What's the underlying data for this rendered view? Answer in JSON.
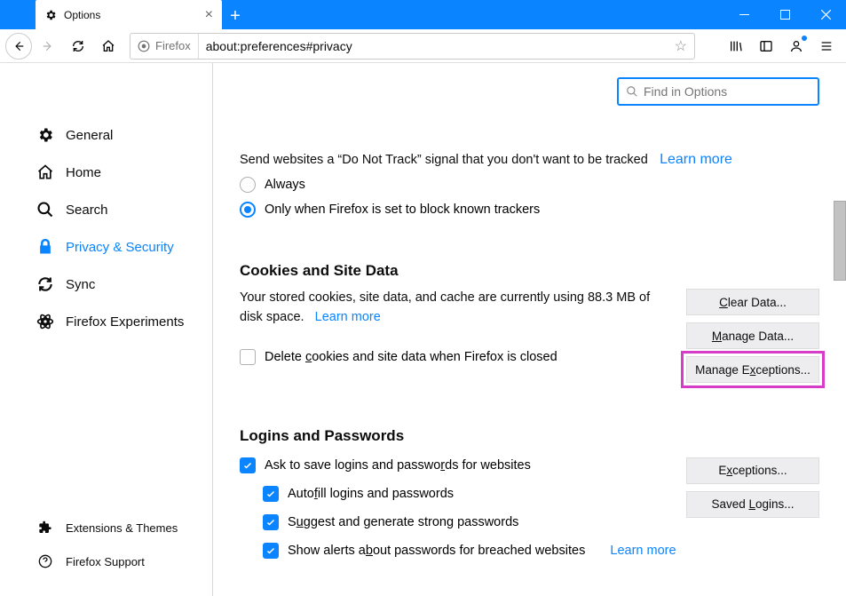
{
  "window": {
    "tab_title": "Options",
    "url": "about:preferences#privacy",
    "identity_label": "Firefox"
  },
  "find": {
    "placeholder": "Find in Options"
  },
  "sidebar": {
    "items": [
      {
        "label": "General",
        "icon": "gear-icon"
      },
      {
        "label": "Home",
        "icon": "home-icon"
      },
      {
        "label": "Search",
        "icon": "search-icon"
      },
      {
        "label": "Privacy & Security",
        "icon": "lock-icon"
      },
      {
        "label": "Sync",
        "icon": "sync-icon"
      },
      {
        "label": "Firefox Experiments",
        "icon": "flask-icon"
      }
    ],
    "bottom": [
      {
        "label": "Extensions & Themes",
        "icon": "puzzle-icon"
      },
      {
        "label": "Firefox Support",
        "icon": "question-icon"
      }
    ]
  },
  "dnt": {
    "text": "Send websites a “Do Not Track” signal that you don't want to be tracked",
    "learn": "Learn more",
    "opt_always": "Always",
    "opt_default": "Only when Firefox is set to block known trackers"
  },
  "cookies": {
    "title": "Cookies and Site Data",
    "body_1": "Your stored cookies, site data, and cache are currently using 88.3 MB of disk space.",
    "learn": "Learn more",
    "usage_mb": 88.3,
    "delete_on_close": "Delete cookies and site data when Firefox is closed",
    "btn_clear": "Clear Data...",
    "btn_manage": "Manage Data...",
    "btn_exceptions": "Manage Exceptions..."
  },
  "logins": {
    "title": "Logins and Passwords",
    "ask": "Ask to save logins and passwords for websites",
    "autofill": "Autofill logins and passwords",
    "suggest": "Suggest and generate strong passwords",
    "alerts": "Show alerts about passwords for breached websites",
    "learn": "Learn more",
    "btn_exceptions": "Exceptions...",
    "btn_saved": "Saved Logins..."
  }
}
